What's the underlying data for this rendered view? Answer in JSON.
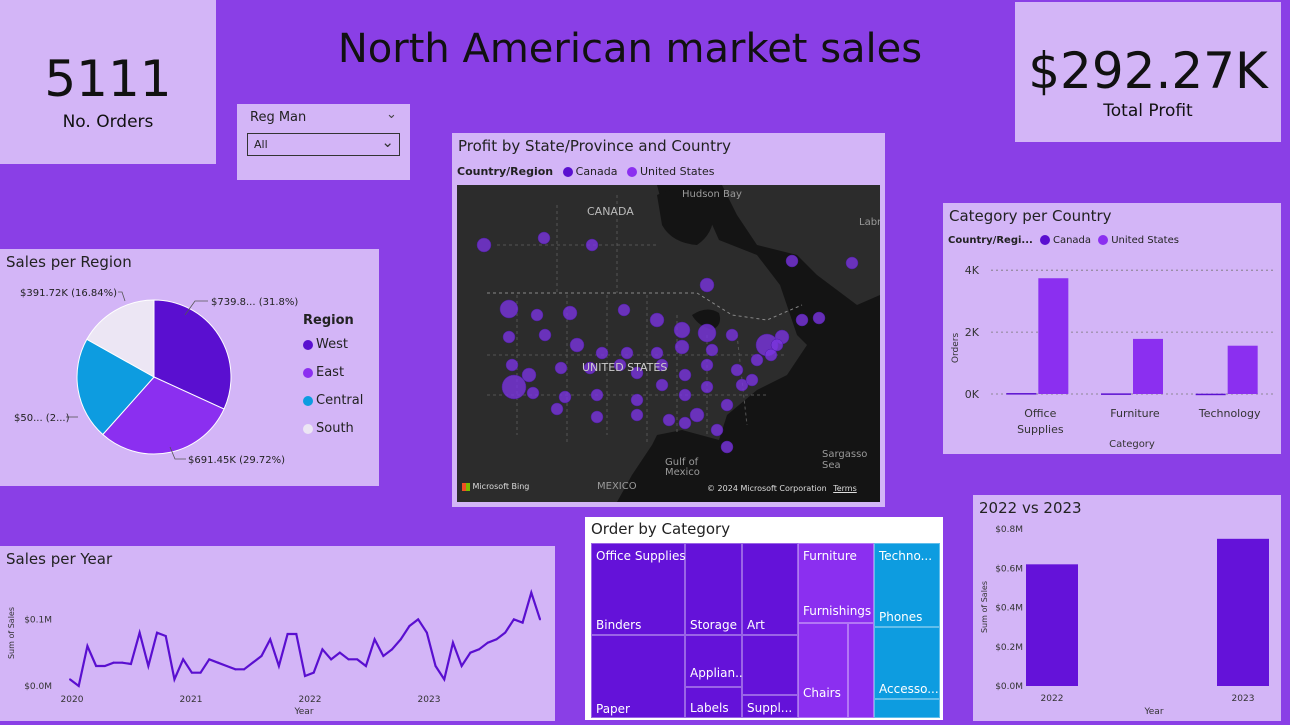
{
  "title": "North American market sales",
  "kpi_orders": {
    "value": "5111",
    "label": "No. Orders"
  },
  "kpi_profit": {
    "value": "$292.27K",
    "label": "Total Profit"
  },
  "slicer": {
    "label": "Reg Man",
    "selected": "All"
  },
  "colors": {
    "background": "#8a3fe6",
    "card": "#d3b5f7",
    "canada": "#5a0fd0",
    "united_states": "#8b2ff0",
    "west": "#5a0fd0",
    "east": "#8b2ff0",
    "central": "#0d9ce0",
    "south": "#ece6f4"
  },
  "map": {
    "title": "Profit by State/Province and Country",
    "legend_title": "Country/Region",
    "legend": [
      "Canada",
      "United States"
    ],
    "labels": {
      "hudson_bay": "Hudson Bay",
      "canada": "CANADA",
      "united_states": "UNITED STATES",
      "gulf": "Gulf of",
      "gulf2": "Mexico",
      "mexico": "MEXICO",
      "sargasso": "Sargasso Sea",
      "labrador": "Labrador"
    },
    "attribution": {
      "brand": "Microsoft Bing",
      "copyright": "© 2024 Microsoft Corporation",
      "terms": "Terms"
    }
  },
  "chart_data": [
    {
      "type": "pie",
      "title": "Sales per Region",
      "legend_title": "Region",
      "categories": [
        "West",
        "East",
        "Central",
        "South"
      ],
      "values": [
        739.8,
        691.45,
        501.24,
        391.72
      ],
      "percent": [
        31.8,
        29.72,
        21.55,
        16.84
      ],
      "data_labels": [
        "$739.8... (31.8%)",
        "$691.45K (29.72%)",
        "$50... (2...)",
        "$391.72K (16.84%)"
      ]
    },
    {
      "type": "bar",
      "title": "Category per Country",
      "legend_title": "Country/Regi...",
      "categories": [
        "Office Supplies",
        "Furniture",
        "Technology"
      ],
      "category_labels": [
        [
          "Office",
          "Supplies"
        ],
        [
          "Furniture"
        ],
        [
          "Technology"
        ]
      ],
      "series": [
        {
          "name": "Canada",
          "values": [
            30,
            20,
            10
          ]
        },
        {
          "name": "United States",
          "values": [
            3740,
            1780,
            1560
          ]
        }
      ],
      "xlabel": "Category",
      "ylabel": "Orders",
      "yticks": [
        "0K",
        "2K",
        "4K"
      ],
      "ytick_values": [
        0,
        2000,
        4000
      ],
      "ylim": [
        0,
        4200
      ]
    },
    {
      "type": "line",
      "title": "Sales per Year",
      "xlabel": "Year",
      "ylabel": "Sum of Sales",
      "xticks": [
        "2020",
        "2021",
        "2022",
        "2023"
      ],
      "yticks": [
        "$0.0M",
        "$0.1M"
      ],
      "ytick_values": [
        0,
        0.1
      ],
      "ylim": [
        0,
        0.165
      ],
      "values": [
        0.01,
        0.0,
        0.06,
        0.03,
        0.03,
        0.035,
        0.035,
        0.033,
        0.08,
        0.03,
        0.08,
        0.075,
        0.01,
        0.04,
        0.02,
        0.02,
        0.04,
        0.035,
        0.03,
        0.025,
        0.025,
        0.035,
        0.045,
        0.07,
        0.03,
        0.078,
        0.078,
        0.015,
        0.02,
        0.055,
        0.04,
        0.05,
        0.04,
        0.04,
        0.03,
        0.07,
        0.045,
        0.055,
        0.07,
        0.09,
        0.1,
        0.08,
        0.03,
        0.01,
        0.065,
        0.03,
        0.05,
        0.055,
        0.065,
        0.07,
        0.08,
        0.1,
        0.095,
        0.14,
        0.1
      ]
    },
    {
      "type": "treemap",
      "title": "Order by Category",
      "groups": [
        {
          "name": "Office Supplies",
          "items": [
            "Binders",
            "Storage",
            "Art",
            "Paper",
            "Appliances",
            "Labels",
            "Supplies"
          ],
          "item_labels": [
            "Binders",
            "Storage",
            "Art",
            "Paper",
            "Applian...",
            "Labels",
            "Suppl..."
          ]
        },
        {
          "name": "Furniture",
          "items": [
            "Furnishings",
            "Chairs"
          ],
          "item_labels": [
            "Furnishings",
            "Chairs"
          ]
        },
        {
          "name": "Technology",
          "label": "Techno...",
          "items": [
            "Phones",
            "Accessories"
          ],
          "item_labels": [
            "Phones",
            "Accesso..."
          ]
        }
      ]
    },
    {
      "type": "bar",
      "title": "2022 vs 2023",
      "categories": [
        "2022",
        "2023"
      ],
      "values": [
        0.62,
        0.75
      ],
      "xlabel": "Year",
      "ylabel": "Sum of Sales",
      "yticks": [
        "$0.0M",
        "$0.2M",
        "$0.4M",
        "$0.6M",
        "$0.8M"
      ],
      "ytick_values": [
        0,
        0.2,
        0.4,
        0.6,
        0.8
      ],
      "ylim": [
        0,
        0.8
      ]
    }
  ]
}
